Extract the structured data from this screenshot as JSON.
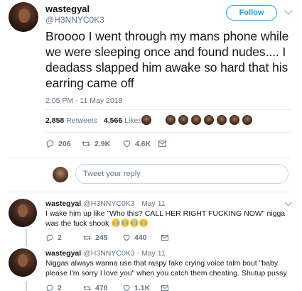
{
  "tweet": {
    "author_name": "wastegyal",
    "author_handle": "@H3NNYC0K3",
    "follow_label": "Follow",
    "text": "Broooo I went through my mans phone while we were sleeping once and found nudes.... I deadass slapped him awake so hard that his earring came off",
    "timestamp": "2:05 PM - 11 May 2018",
    "retweets_count": "2,858",
    "retweets_label": "Retweets",
    "likes_count": "4,566",
    "likes_label": "Likes",
    "actions": {
      "reply": "206",
      "retweet": "2.9K",
      "like": "4.6K"
    }
  },
  "reply_box": {
    "placeholder": "Tweet your reply"
  },
  "replies": [
    {
      "author_name": "wastegyal",
      "meta": "@H3NNYC0K3 · May 11",
      "text": "I wake him up like \"Who this? CALL HER RIGHT FUCKING NOW\" nigga was the fuck shook",
      "emoji_count": 4,
      "actions": {
        "reply": "2",
        "retweet": "245",
        "like": "440"
      }
    },
    {
      "author_name": "wastegyal",
      "meta": "@H3NNYC0K3 · May 11",
      "text": "Niggas always wanna use that raspy fake crying voice talm bout \"baby please I'm sorry I love you\" when you catch them cheating. Shutup pussy",
      "actions": {
        "reply": "2",
        "retweet": "470",
        "like": "1.1K"
      }
    }
  ],
  "colors": {
    "accent": "#1da1f2",
    "text": "#14171a",
    "muted": "#657786",
    "divider": "#e6ecf0"
  }
}
